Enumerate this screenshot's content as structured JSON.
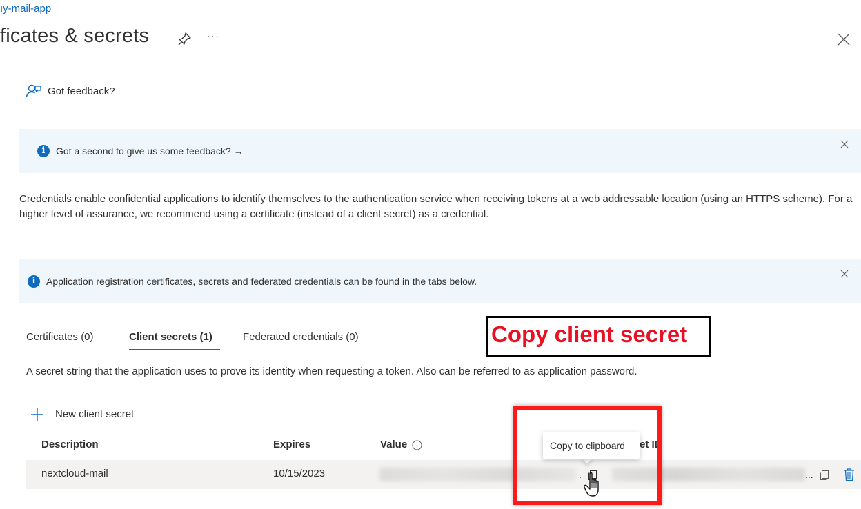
{
  "header": {
    "breadcrumb": "ıy-mail-app",
    "title": "ficates & secrets",
    "more_label": "···"
  },
  "feedback": {
    "label": "Got feedback?"
  },
  "banners": [
    {
      "text": "Got a second to give us some feedback? →"
    },
    {
      "text": "Application registration certificates, secrets and federated credentials can be found in the tabs below."
    }
  ],
  "description": "Credentials enable confidential applications to identify themselves to the authentication service when receiving tokens at a web addressable location (using an HTTPS scheme). For a higher level of assurance, we recommend using a certificate (instead of a client secret) as a credential.",
  "tabs": [
    {
      "label": "Certificates (0)",
      "active": false
    },
    {
      "label": "Client secrets (1)",
      "active": true
    },
    {
      "label": "Federated credentials (0)",
      "active": false
    }
  ],
  "callout": {
    "text": "Copy client secret"
  },
  "helper_text": "A secret string that the application uses to prove its identity when requesting a token. Also can be referred to as application password.",
  "new_secret_label": "New client secret",
  "table": {
    "columns": [
      "Description",
      "Expires",
      "Value",
      "et ID"
    ],
    "rows": [
      {
        "description": "nextcloud-mail",
        "expires": "10/15/2023",
        "value_trail": ".",
        "secret_id_trail": "..."
      }
    ]
  },
  "tooltip": {
    "text": "Copy to clipboard"
  },
  "colors": {
    "accent": "#0f6cbd",
    "banner_bg": "#eff6fc",
    "highlight": "#ff1a1a",
    "callout_text": "#e81123"
  }
}
